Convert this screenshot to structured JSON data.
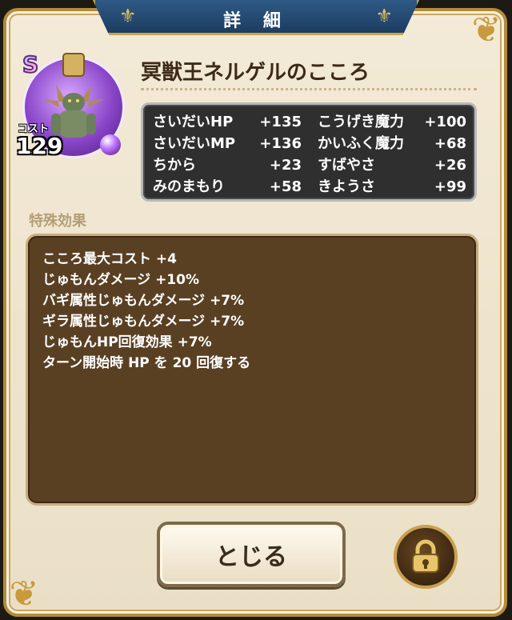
{
  "dialog": {
    "title": "詳 細"
  },
  "monster": {
    "rank": "S",
    "cost_label": "コスト",
    "cost": "129",
    "name": "冥獣王ネルゲルのこころ"
  },
  "stats": [
    {
      "name_left": "さいだいHP",
      "value_left": "+135",
      "name_right": "こうげき魔力",
      "value_right": "+100"
    },
    {
      "name_left": "さいだいMP",
      "value_left": "+136",
      "name_right": "かいふく魔力",
      "value_right": "+68"
    },
    {
      "name_left": "ちから",
      "value_left": "+23",
      "name_right": "すばやさ",
      "value_right": "+26"
    },
    {
      "name_left": "みのまもり",
      "value_left": "+58",
      "name_right": "きようさ",
      "value_right": "+99"
    }
  ],
  "effects": {
    "label": "特殊効果",
    "lines": [
      "こころ最大コスト +4",
      "じゅもんダメージ +10%",
      "バギ属性じゅもんダメージ +7%",
      "ギラ属性じゅもんダメージ +7%",
      "じゅもんHP回復効果 +7%",
      "ターン開始時 HP を 20 回復する"
    ]
  },
  "buttons": {
    "close_label": "とじる"
  },
  "icons": {
    "corner": "ornament-icon",
    "title_fleur": "fleur-de-lis-icon",
    "lock": "padlock-icon",
    "orb": "purple-orb-icon"
  },
  "colors": {
    "title_banner": "#1d3c60",
    "panel_bg": "#f3ead7",
    "stats_bg": "#2f2f30",
    "effects_bg": "#5a4023",
    "rank_purple": "#8a46c9"
  }
}
